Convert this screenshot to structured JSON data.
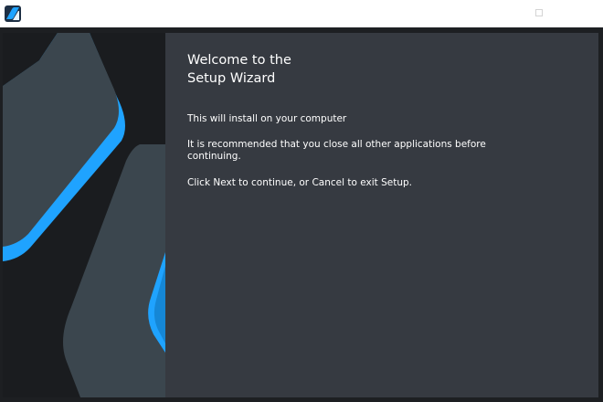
{
  "window": {
    "app_icon": "setup-app-icon",
    "maximize_icon": "maximize-icon"
  },
  "wizard": {
    "title_line1": "Welcome to the",
    "title_line2": "Setup Wizard",
    "install_text": "This will install on your computer",
    "recommend_text": "It is recommended that you close all other applications before continuing.",
    "continue_text": "Click Next to continue, or Cancel to exit Setup."
  },
  "colors": {
    "accent": "#1fa3ff",
    "panel": "#363a41",
    "banner_shape": "#3b464e",
    "background": "#1d1f22"
  }
}
